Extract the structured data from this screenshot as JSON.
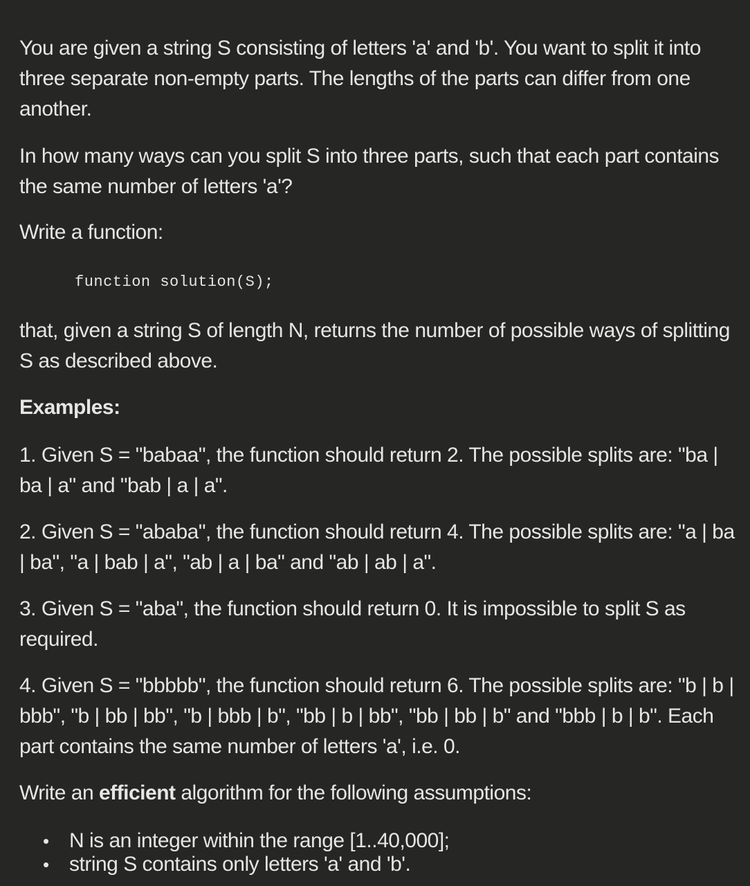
{
  "paragraphs": {
    "intro": "You are given a string S consisting of letters 'a' and 'b'. You want to split it into three separate non-empty parts. The lengths of the parts can differ from one another.",
    "question": "In how many ways can you split S into three parts, such that each part contains the same number of letters 'a'?",
    "write_function": "Write a function:",
    "code": "function solution(S);",
    "description": "that, given a string S of length N, returns the number of possible ways of splitting S as described above."
  },
  "examples": {
    "heading": "Examples:",
    "items": [
      "1. Given S = \"babaa\", the function should return 2. The possible splits are: \"ba | ba | a\" and \"bab | a | a\".",
      "2. Given S = \"ababa\", the function should return 4. The possible splits are: \"a | ba | ba\", \"a | bab | a\", \"ab | a | ba\" and \"ab | ab | a\".",
      "3. Given S = \"aba\", the function should return 0. It is impossible to split S as required.",
      "4. Given S = \"bbbbb\", the function should return 6. The possible splits are: \"b | b | bbb\", \"b | bb | bb\", \"b | bbb | b\", \"bb | b | bb\", \"bb | bb | b\" and \"bbb | b | b\". Each part contains the same number of letters 'a', i.e. 0."
    ]
  },
  "assumptions": {
    "intro_before": "Write an ",
    "intro_bold": "efficient",
    "intro_after": " algorithm for the following assumptions:",
    "bullet_glyph": "•",
    "items": [
      "N is an integer within the range [1..40,000];",
      "string S contains only letters 'a' and 'b'."
    ]
  }
}
